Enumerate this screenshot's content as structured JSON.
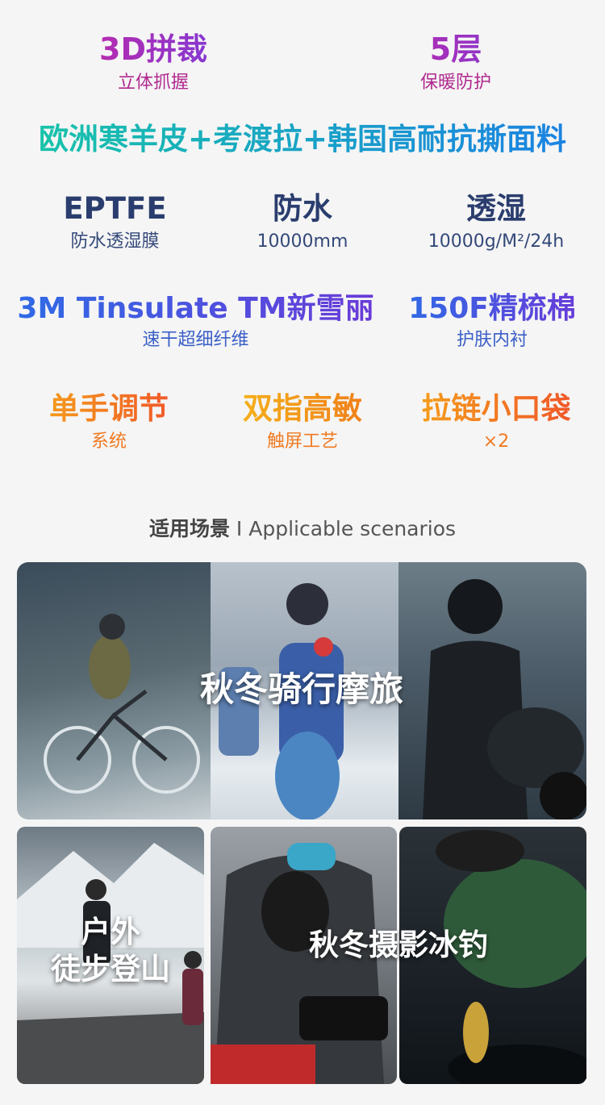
{
  "features": {
    "row1": [
      {
        "title": "3D拼裁",
        "sub": "立体抓握"
      },
      {
        "title": "5层",
        "sub": "保暖防护"
      }
    ],
    "material": "欧洲寒羊皮+考渡拉+韩国高耐抗撕面料",
    "row2": [
      {
        "title": "EPTFE",
        "sub": "防水透湿膜"
      },
      {
        "title": "防水",
        "sub": "10000mm"
      },
      {
        "title": "透湿",
        "sub": "10000g/M²/24h"
      }
    ],
    "row3": [
      {
        "title": "3M Tinsulate TM新雪丽",
        "sub": "速干超细纤维"
      },
      {
        "title": "150F精梳棉",
        "sub": "护肤内衬"
      }
    ],
    "row4": [
      {
        "title": "单手调节",
        "sub": "系统"
      },
      {
        "title": "双指高敏",
        "sub": "触屏工艺"
      },
      {
        "title": "拉链小口袋",
        "sub": "×2"
      }
    ]
  },
  "scenarios": {
    "title_cn": "适用场景",
    "title_sep": " I ",
    "title_en": "Applicable scenarios",
    "panels": {
      "riding": "秋冬骑行摩旅",
      "hiking_line1": "户外",
      "hiking_line2": "徒步登山",
      "photo_fishing": "秋冬摄影冰钓"
    }
  }
}
